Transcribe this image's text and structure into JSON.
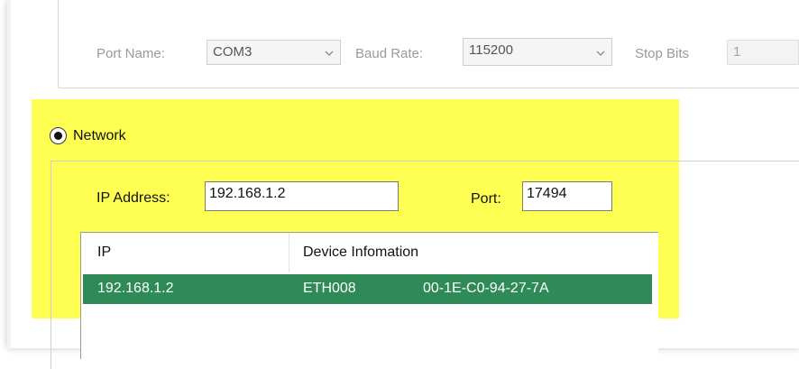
{
  "serial": {
    "port_name_label": "Port Name:",
    "port_name_value": "COM3",
    "baud_rate_label": "Baud Rate:",
    "baud_rate_value": "115200",
    "stop_bits_label": "Stop Bits",
    "stop_bits_value": "1"
  },
  "network": {
    "label": "Network",
    "selected": true,
    "ip_address_label": "IP Address:",
    "ip_address_value": "192.168.1.2",
    "port_label": "Port:",
    "port_value": "17494"
  },
  "device_list": {
    "columns": [
      "IP",
      "Device Infomation"
    ],
    "rows": [
      {
        "ip": "192.168.1.2",
        "device": "ETH008",
        "mac": "00-1E-C0-94-27-7A",
        "selected": true
      }
    ]
  },
  "colors": {
    "highlight": "#ffff10",
    "selected_row": "#2e8b57"
  },
  "icons": {
    "combo_arrow": "chevron-down-icon",
    "radio_selected": "radio-selected-icon"
  }
}
